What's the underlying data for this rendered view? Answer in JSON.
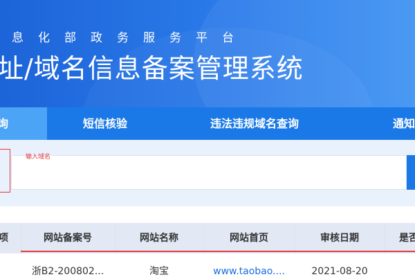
{
  "header": {
    "subtitle": "息化部政务服务平台",
    "title": "址/域名信息备案管理系统"
  },
  "nav": {
    "tabs": [
      {
        "label": "询",
        "active": true
      },
      {
        "label": "短信核验",
        "active": false
      },
      {
        "label": "违法违规域名查询",
        "active": false
      },
      {
        "label": "通知",
        "active": false
      }
    ]
  },
  "search": {
    "placeholder": "",
    "annotation": "输入域名"
  },
  "table": {
    "headers": [
      "项",
      "网站备案号",
      "网站名称",
      "网站首页",
      "审核日期",
      "是否"
    ],
    "rows": [
      [
        "",
        "浙B2-200802...",
        "淘宝",
        "www.taobao....",
        "2021-08-20",
        ""
      ]
    ]
  },
  "colors": {
    "header_blue": "#1c64d8",
    "nav_blue": "#1a79e6",
    "active_tab": "#4ba4f6",
    "annotation_red": "#e23a3a",
    "link_blue": "#1a6fe0"
  }
}
